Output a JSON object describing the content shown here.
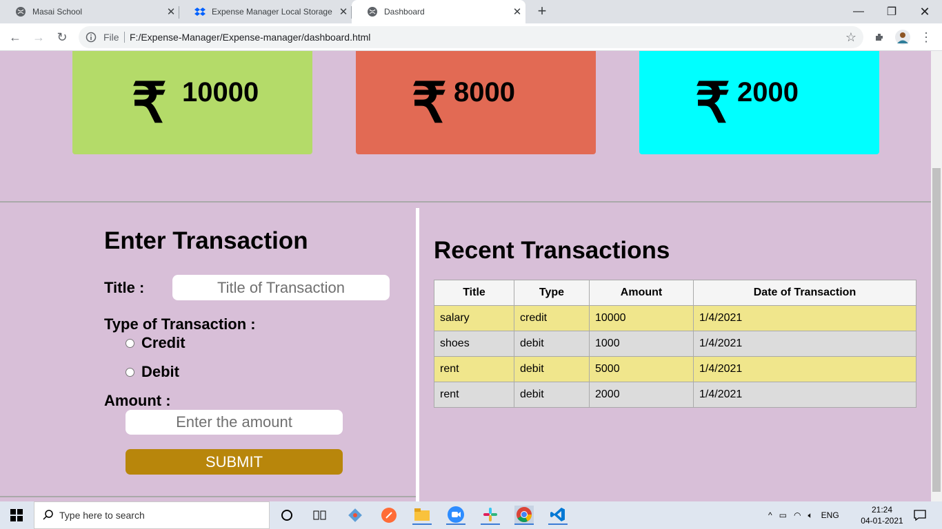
{
  "browser": {
    "tabs": [
      {
        "title": "Masai School"
      },
      {
        "title": "Expense Manager Local Storage DOM"
      },
      {
        "title": "Dashboard"
      }
    ],
    "address": {
      "scheme": "File",
      "url": "F:/Expense-Manager/Expense-manager/dashboard.html"
    }
  },
  "cards": [
    {
      "symbol": "₹",
      "amount": "10000",
      "color": "#b4db69"
    },
    {
      "symbol": "₹",
      "amount": "8000",
      "color": "#e26a54"
    },
    {
      "symbol": "₹",
      "amount": "2000",
      "color": "#00ffff"
    }
  ],
  "form": {
    "heading": "Enter Transaction",
    "title_label": "Title :",
    "title_placeholder": "Title of Transaction",
    "type_label": "Type of Transaction :",
    "credit_label": "Credit",
    "debit_label": "Debit",
    "amount_label": "Amount :",
    "amount_placeholder": "Enter the amount",
    "submit_label": "SUBMIT"
  },
  "transactions": {
    "heading": "Recent Transactions",
    "columns": [
      "Title",
      "Type",
      "Amount",
      "Date of Transaction"
    ],
    "rows": [
      [
        "salary",
        "credit",
        "10000",
        "1/4/2021"
      ],
      [
        "shoes",
        "debit",
        "1000",
        "1/4/2021"
      ],
      [
        "rent",
        "debit",
        "5000",
        "1/4/2021"
      ],
      [
        "rent",
        "debit",
        "2000",
        "1/4/2021"
      ]
    ]
  },
  "taskbar": {
    "search_placeholder": "Type here to search",
    "language": "ENG",
    "time": "21:24",
    "date": "04-01-2021"
  }
}
